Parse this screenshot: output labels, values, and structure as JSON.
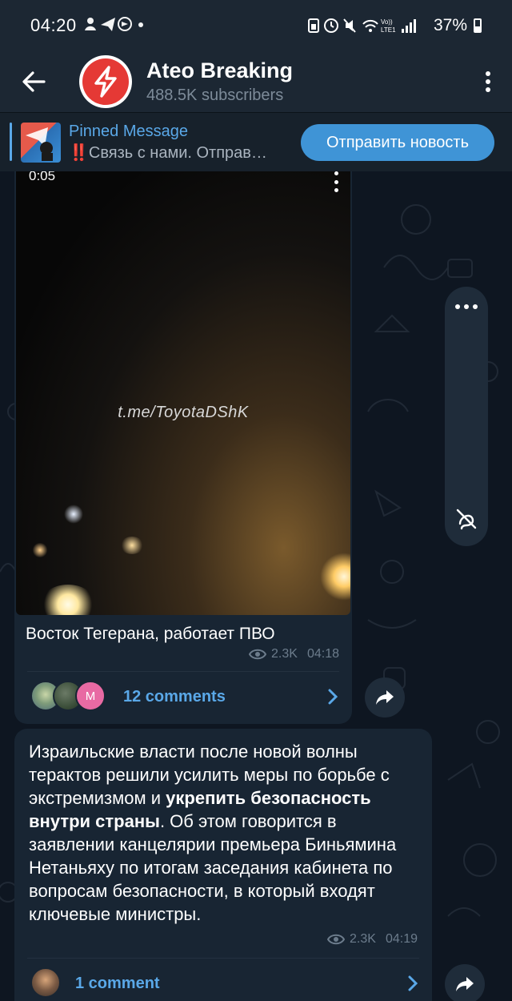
{
  "status_bar": {
    "time": "04:20",
    "battery": "37%",
    "network_top": "Vo))",
    "network_bottom": "LTE1"
  },
  "header": {
    "title": "Ateo Breaking",
    "subtitle": "488.5K subscribers"
  },
  "pinned": {
    "label": "Pinned Message",
    "text": "‼️Связь с нами.  Отправ…",
    "action_label": "Отправить новость"
  },
  "messages": [
    {
      "type": "video",
      "video_duration": "0:05",
      "watermark": "t.me/ToyotaDShK",
      "caption": "Восток Тегерана, работает ПВО",
      "views": "2.3K",
      "time": "04:18",
      "comments_label": "12 comments",
      "avatar_letter": "M"
    },
    {
      "type": "text",
      "text_parts": {
        "p1": "Израильские власти после новой волны терактов решили усилить меры по борьбе с экстремизмом и ",
        "bold": "укрепить безопасность внутри страны",
        "p2": ". Об этом говорится в заявлении канцелярии премьера Биньямина Нетаньяху по итогам заседания кабинета по вопросам безопасности, в который входят ключевые министры."
      },
      "views": "2.3K",
      "time": "04:19",
      "comments_label": "1 comment"
    }
  ],
  "colors": {
    "header_bg": "#1c2733",
    "chat_bg": "#0e1621",
    "bubble_bg": "#182533",
    "accent": "#5aa8e8",
    "button": "#3f94d6",
    "avatar_red": "#e53935"
  },
  "icons": {
    "back": "arrow-left-icon",
    "menu": "more-vertical-icon",
    "channel_avatar": "lightning-bolt-icon",
    "views": "eye-icon",
    "chevron": "chevron-right-icon",
    "share": "share-arrow-icon",
    "side_options": "more-horizontal-icon",
    "side_mute": "no-reactions-icon"
  }
}
